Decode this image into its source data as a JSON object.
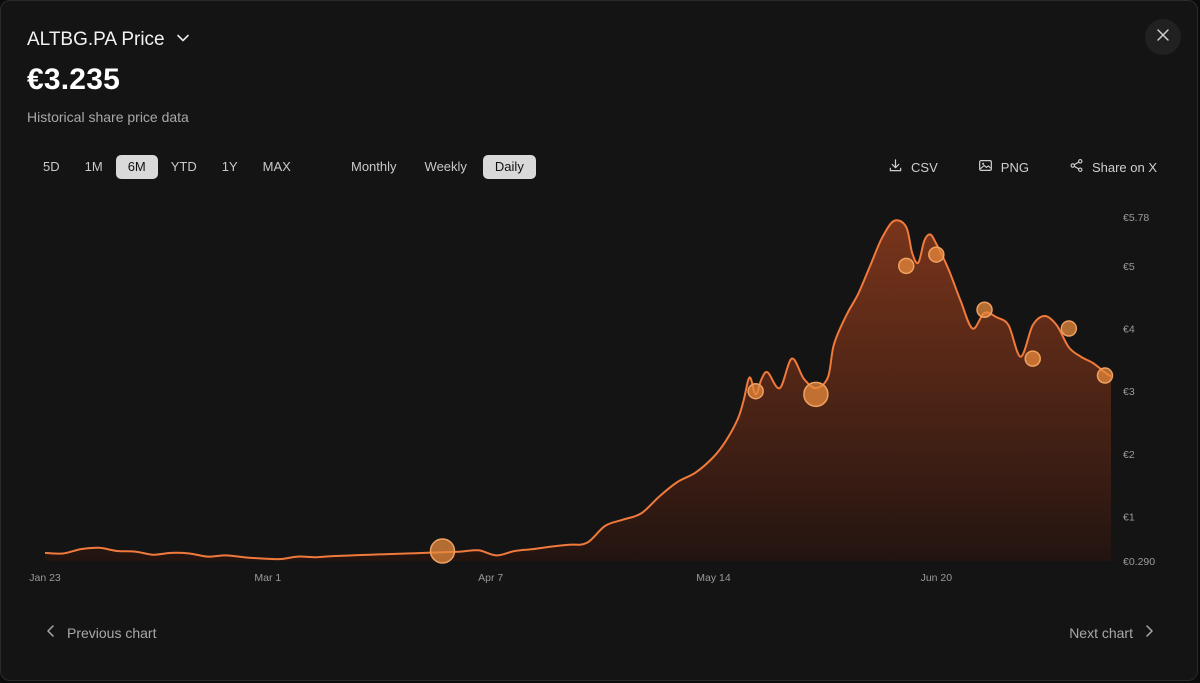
{
  "header": {
    "title": "ALTBG.PA Price",
    "price": "€3.235",
    "subtitle": "Historical share price data"
  },
  "ranges": [
    "5D",
    "1M",
    "6M",
    "YTD",
    "1Y",
    "MAX"
  ],
  "active_range": "6M",
  "frequencies": [
    "Monthly",
    "Weekly",
    "Daily"
  ],
  "active_frequency": "Daily",
  "actions": {
    "csv": "CSV",
    "png": "PNG",
    "share": "Share on X"
  },
  "footer": {
    "prev": "Previous chart",
    "next": "Next chart"
  },
  "colors": {
    "accent": "#f07a3c",
    "marker": "#e8893c",
    "background": "#141414"
  },
  "chart_data": {
    "type": "area",
    "x_labels": [
      "Jan 23",
      "Mar 1",
      "Apr 7",
      "May 14",
      "Jun 20"
    ],
    "y_ticks": [
      "€0.290",
      "€1",
      "€2",
      "€3",
      "€4",
      "€5",
      "€5.78"
    ],
    "y_tick_values": [
      0.29,
      1,
      2,
      3,
      4,
      5,
      5.78
    ],
    "ylim": [
      0.29,
      5.78
    ],
    "xlim": [
      "2025-01-23",
      "2025-07-19"
    ],
    "dates": [
      "2025-01-23",
      "2025-01-26",
      "2025-01-29",
      "2025-02-01",
      "2025-02-04",
      "2025-02-07",
      "2025-02-10",
      "2025-02-13",
      "2025-02-16",
      "2025-02-19",
      "2025-02-22",
      "2025-02-25",
      "2025-02-28",
      "2025-03-03",
      "2025-03-06",
      "2025-03-09",
      "2025-03-12",
      "2025-03-15",
      "2025-03-18",
      "2025-03-21",
      "2025-03-24",
      "2025-03-27",
      "2025-03-30",
      "2025-04-02",
      "2025-04-05",
      "2025-04-08",
      "2025-04-11",
      "2025-04-14",
      "2025-04-17",
      "2025-04-20",
      "2025-04-23",
      "2025-04-26",
      "2025-04-29",
      "2025-05-02",
      "2025-05-05",
      "2025-05-08",
      "2025-05-11",
      "2025-05-14",
      "2025-05-16",
      "2025-05-18",
      "2025-05-19",
      "2025-05-20",
      "2025-05-21",
      "2025-05-22",
      "2025-05-23",
      "2025-05-25",
      "2025-05-27",
      "2025-05-29",
      "2025-05-31",
      "2025-06-02",
      "2025-06-03",
      "2025-06-05",
      "2025-06-07",
      "2025-06-09",
      "2025-06-11",
      "2025-06-13",
      "2025-06-15",
      "2025-06-16",
      "2025-06-17",
      "2025-06-18",
      "2025-06-19",
      "2025-06-20",
      "2025-06-22",
      "2025-06-24",
      "2025-06-26",
      "2025-06-28",
      "2025-06-30",
      "2025-07-02",
      "2025-07-04",
      "2025-07-06",
      "2025-07-08",
      "2025-07-10",
      "2025-07-12",
      "2025-07-14",
      "2025-07-16",
      "2025-07-18",
      "2025-07-19"
    ],
    "series": [
      {
        "values": [
          0.42,
          0.41,
          0.48,
          0.5,
          0.45,
          0.44,
          0.39,
          0.42,
          0.41,
          0.36,
          0.38,
          0.35,
          0.33,
          0.32,
          0.36,
          0.35,
          0.37,
          0.38,
          0.39,
          0.4,
          0.41,
          0.42,
          0.43,
          0.44,
          0.46,
          0.38,
          0.45,
          0.48,
          0.52,
          0.55,
          0.58,
          0.85,
          0.95,
          1.05,
          1.32,
          1.55,
          1.7,
          1.95,
          2.2,
          2.55,
          2.85,
          3.22,
          2.95,
          3.2,
          3.3,
          3.05,
          3.52,
          3.2,
          3.05,
          3.22,
          3.75,
          4.2,
          4.55,
          5.0,
          5.45,
          5.72,
          5.62,
          5.2,
          5.05,
          5.4,
          5.5,
          5.35,
          4.95,
          4.45,
          4.0,
          4.25,
          4.18,
          4.05,
          3.55,
          4.05,
          4.2,
          4.05,
          3.7,
          3.55,
          3.45,
          3.3,
          3.235
        ]
      }
    ],
    "markers": [
      {
        "date": "2025-03-30",
        "value": 0.45,
        "size": "large"
      },
      {
        "date": "2025-05-21",
        "value": 3.0,
        "size": "small"
      },
      {
        "date": "2025-05-31",
        "value": 2.95,
        "size": "large"
      },
      {
        "date": "2025-06-15",
        "value": 5.0,
        "size": "small"
      },
      {
        "date": "2025-06-20",
        "value": 5.18,
        "size": "small"
      },
      {
        "date": "2025-06-28",
        "value": 4.3,
        "size": "small"
      },
      {
        "date": "2025-07-06",
        "value": 3.52,
        "size": "small"
      },
      {
        "date": "2025-07-12",
        "value": 4.0,
        "size": "small"
      },
      {
        "date": "2025-07-18",
        "value": 3.25,
        "size": "small"
      }
    ]
  }
}
